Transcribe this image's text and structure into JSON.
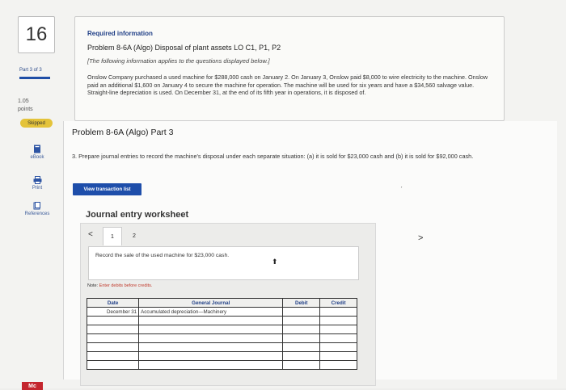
{
  "sidebar": {
    "question_number": "16",
    "part_label": "Part 3 of 3",
    "points_value": "1.05",
    "points_label": "points",
    "skipped_badge": "Skipped",
    "tools": [
      {
        "label": "eBook",
        "icon": "ebook-icon"
      },
      {
        "label": "Print",
        "icon": "print-icon"
      },
      {
        "label": "References",
        "icon": "references-icon"
      }
    ],
    "logo_text": "Mc"
  },
  "required": {
    "title": "Required information",
    "problem": "Problem 8-6A (Algo) Disposal of plant assets LO C1, P1, P2",
    "italic_note": "[The following information applies to the questions displayed below.]",
    "body": "Onslow Company purchased a used machine for $288,000 cash on January 2. On January 3, Onslow paid $8,000 to wire electricity to the machine. Onslow paid an additional $1,600 on January 4 to secure the machine for operation. The machine will be used for six years and have a $34,560 salvage value. Straight-line depreciation is used. On December 31, at the end of its fifth year in operations, it is disposed of."
  },
  "main": {
    "part_title": "Problem 8-6A (Algo) Part 3",
    "instructions": "3. Prepare journal entries to record the machine's disposal under each separate situation: (a) it is sold for $23,000 cash and (b) it is sold for $92,000 cash.",
    "view_button": "View transaction list",
    "caret_mark": "ˏ"
  },
  "worksheet": {
    "title": "Journal entry worksheet",
    "prev_arrow": "<",
    "next_arrow": ">",
    "tabs": [
      "1",
      "2"
    ],
    "description": "Record the sale of the used machine for $23,000 cash.",
    "note_prefix": "Note:",
    "note_text": " Enter debits before credits.",
    "columns": {
      "date": "Date",
      "account": "General Journal",
      "debit": "Debit",
      "credit": "Credit"
    },
    "rows": [
      {
        "date": "December 31",
        "account": "Accumulated depreciation—Machinery",
        "debit": "",
        "credit": ""
      },
      {
        "date": "",
        "account": "",
        "debit": "",
        "credit": ""
      },
      {
        "date": "",
        "account": "",
        "debit": "",
        "credit": ""
      },
      {
        "date": "",
        "account": "",
        "debit": "",
        "credit": ""
      },
      {
        "date": "",
        "account": "",
        "debit": "",
        "credit": ""
      },
      {
        "date": "",
        "account": "",
        "debit": "",
        "credit": ""
      },
      {
        "date": "",
        "account": "",
        "debit": "",
        "credit": ""
      }
    ]
  },
  "colors": {
    "accent": "#1f4ea6",
    "skipped": "#e4c33a",
    "logo": "#c4262e"
  }
}
